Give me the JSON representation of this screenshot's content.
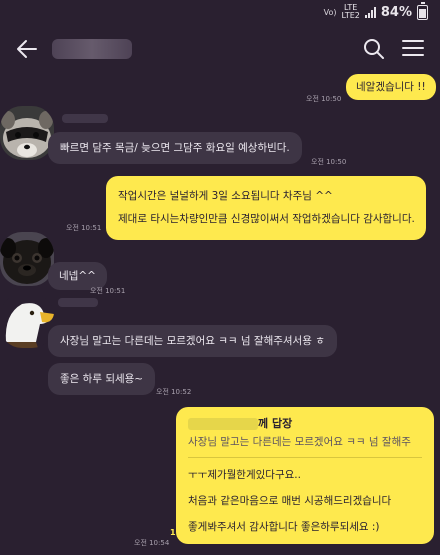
{
  "status": {
    "signal_small": "Vo)",
    "network_top": "LTE",
    "network_bottom": "LTE2",
    "battery": "84%"
  },
  "header": {
    "back_icon": "arrow-left-icon",
    "search_icon": "search-icon",
    "menu_icon": "hamburger-menu-icon"
  },
  "messages": [
    {
      "id": "m1",
      "text": "네알겠습니다 !!",
      "time": "오전 10:50"
    },
    {
      "id": "m2",
      "text": "빠르면 담주 목금/ 늦으면 그담주 화요일 예상하빈다.",
      "time": "오전 10:50"
    },
    {
      "id": "m3",
      "line1": "작업시간은 널널하게 3일 소요됩니다 차주님 ^^",
      "line2": "제대로 타시는차량인만큼 신경많이써서 작업하겠습니다 감사합니다.",
      "time": "오전 10:51"
    },
    {
      "id": "m4",
      "text": "네넵^^",
      "time": "오전 10:51"
    },
    {
      "id": "m5",
      "text": "사장님 말고는 다른데는 모르겠어요 ㅋㅋ 넘 잘해주셔서용 ㅎ"
    },
    {
      "id": "m6",
      "text": "좋은 하루 되세용~",
      "time": "오전 10:52"
    },
    {
      "id": "m7",
      "reply_head": "께 답장",
      "quote": "사장님 말고는 다른데는 모르겠어요 ㅋㅋ 넘 잘해주",
      "line1": "ㅜㅜ제가뭘한게있다구요..",
      "line2": "처음과 같은마음으로 매번 시공해드리겠습니다",
      "line3": "좋게봐주셔서 감사합니다 좋은하루되세요 :)",
      "unread": "1",
      "time": "오전 10:54"
    }
  ]
}
